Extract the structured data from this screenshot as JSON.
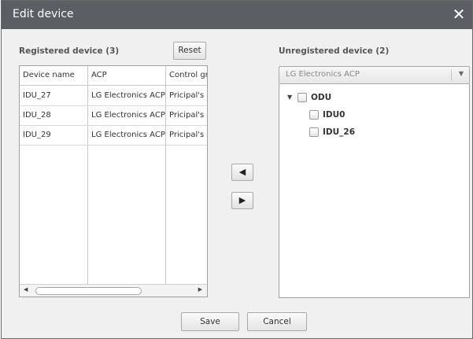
{
  "dialog": {
    "title": "Edit device",
    "close_icon": "close-icon"
  },
  "registered": {
    "label": "Registered device (3)",
    "reset_label": "Reset",
    "columns": [
      "Device name",
      "ACP",
      "Control gro"
    ],
    "rows": [
      [
        "IDU_27",
        "LG Electronics ACP",
        "Pricipal's o"
      ],
      [
        "IDU_28",
        "LG Electronics ACP",
        "Pricipal's o"
      ],
      [
        "IDU_29",
        "LG Electronics ACP",
        "Pricipal's o"
      ]
    ]
  },
  "transfer": {
    "left_icon": "arrow-left-icon",
    "left_glyph": "◀",
    "right_icon": "arrow-right-icon",
    "right_glyph": "▶"
  },
  "unregistered": {
    "label": "Unregistered device (2)",
    "select_value": "LG Electronics ACP",
    "tree": {
      "root": "ODU",
      "children": [
        "IDU0",
        "IDU_26"
      ]
    }
  },
  "footer": {
    "save_label": "Save",
    "cancel_label": "Cancel"
  },
  "colors": {
    "titlebar": "#5b5e63",
    "dialog_bg": "#f0f0f0"
  }
}
